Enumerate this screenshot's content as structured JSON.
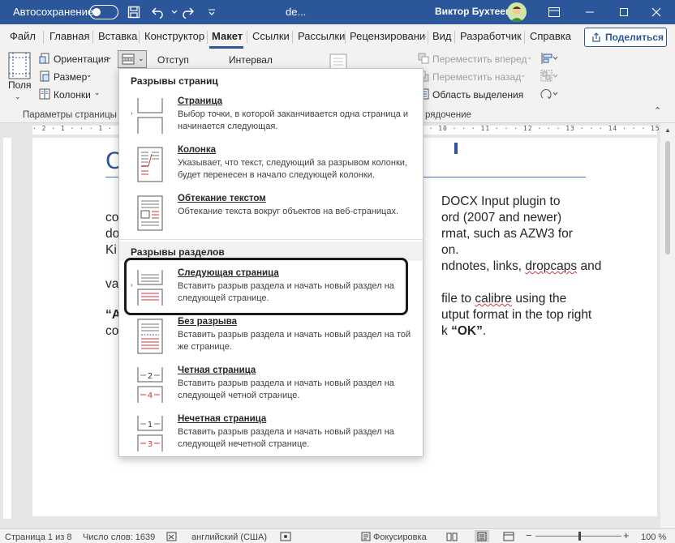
{
  "titlebar": {
    "autosave_label": "Автосохранение",
    "doc_name": "de...",
    "user_name": "Виктор Бухтеев",
    "bg_color": "#2b579a"
  },
  "tabs": [
    "Файл",
    "Главная",
    "Вставка",
    "Конструктор",
    "Макет",
    "Ссылки",
    "Рассылки",
    "Рецензирование",
    "Вид",
    "Разработчик",
    "Справка"
  ],
  "active_tab": "Макет",
  "share_label": "Поделиться",
  "ribbon": {
    "margins_label": "Поля",
    "orientation_label": "Ориентация",
    "size_label": "Размер",
    "columns_label": "Колонки",
    "indent_label": "Отступ",
    "spacing_label": "Интервал",
    "move_forward": "Переместить вперед",
    "move_back": "Переместить назад",
    "selection_pane": "Область выделения",
    "group_page_setup": "Параметры страницы",
    "group_arrange": "рядочение"
  },
  "ruler_text": "· 2 · 1 · · · 1 · · · 2 · · · 3 · · · 4 · · · 5 · · · 6 · · · 7 · · · 8 · · · 9 · · · 10 · · · 11 · · · 12 · · · 13 · · · 14 · · · 15 · · · 16 · · · 17 · · 18",
  "document": {
    "heading_fragment": "C",
    "lines": [
      "DOCX Input plugin to",
      "co",
      "ord (2007 and newer)",
      "do",
      "rmat, such as AZW3 for",
      "Ki",
      "on.",
      "ndnotes, links, ",
      "dropcaps",
      " and",
      "va",
      " file to ",
      "calibre",
      " using the",
      "“A",
      "utput format in the top right",
      "co",
      "k ",
      "“OK”",
      "."
    ]
  },
  "dropdown": {
    "section_page_breaks": "Разрывы страниц",
    "section_section_breaks": "Разрывы разделов",
    "items": [
      {
        "title": "Страница",
        "desc": "Выбор точки, в которой заканчивается одна страница и начинается следующая."
      },
      {
        "title": "Колонка",
        "desc": "Указывает, что текст, следующий за разрывом колонки, будет перенесен в начало следующей колонки."
      },
      {
        "title": "Обтекание текстом",
        "desc": "Обтекание текста вокруг объектов на веб-страницах."
      },
      {
        "title": "Следующая страница",
        "desc": "Вставить разрыв раздела и начать новый раздел на следующей странице."
      },
      {
        "title": "Без разрыва",
        "desc": "Вставить разрыв раздела и начать новый раздел на той же странице."
      },
      {
        "title": "Четная страница",
        "desc": "Вставить разрыв раздела и начать новый раздел на следующей четной странице."
      },
      {
        "title": "Нечетная страница",
        "desc": "Вставить разрыв раздела и начать новый раздел на следующей нечетной странице."
      }
    ],
    "icon_even_label": "2",
    "icon_even_next": "4",
    "icon_odd_label": "1",
    "icon_odd_next": "3"
  },
  "statusbar": {
    "page": "Страница 1 из 8",
    "words": "Число слов: 1639",
    "language": "английский (США)",
    "focus": "Фокусировка",
    "zoom": "100 %",
    "minus": "−",
    "plus": "+"
  },
  "colors": {
    "accent": "#2b579a",
    "break_red": "#d13438"
  }
}
